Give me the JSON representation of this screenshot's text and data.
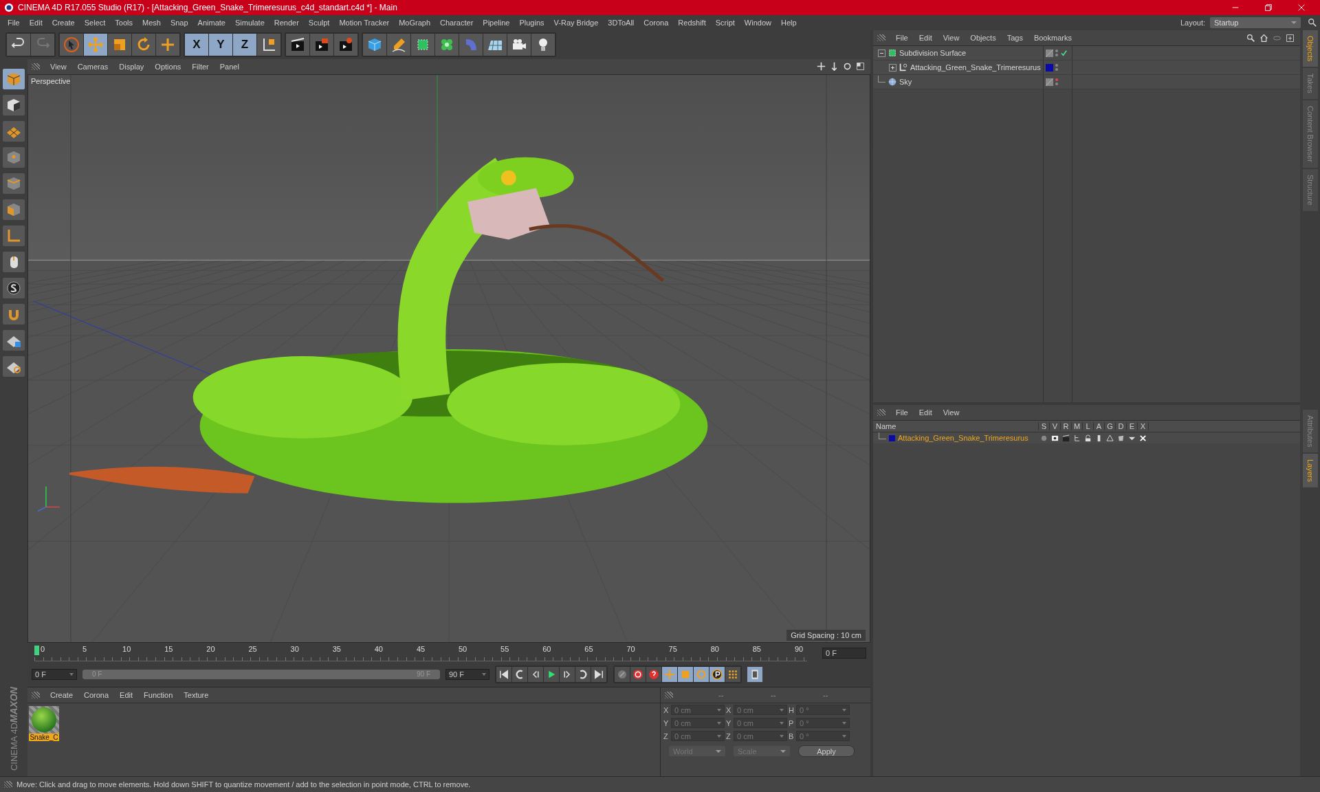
{
  "title_bar": {
    "title": "CINEMA 4D R17.055 Studio (R17) - [Attacking_Green_Snake_Trimeresurus_c4d_standart.c4d *] - Main"
  },
  "menu_bar": {
    "items": [
      "File",
      "Edit",
      "Create",
      "Select",
      "Tools",
      "Mesh",
      "Snap",
      "Animate",
      "Simulate",
      "Render",
      "Sculpt",
      "Motion Tracker",
      "MoGraph",
      "Character",
      "Pipeline",
      "Plugins",
      "V-Ray Bridge",
      "3DToAll",
      "Corona",
      "Redshift",
      "Script",
      "Window",
      "Help"
    ],
    "layout_label": "Layout:",
    "layout_value": "Startup"
  },
  "toolbar": {
    "axis_buttons": [
      {
        "label": "X",
        "on": true
      },
      {
        "label": "Y",
        "on": true
      },
      {
        "label": "Z",
        "on": true
      }
    ]
  },
  "viewport": {
    "menu": [
      "View",
      "Cameras",
      "Display",
      "Options",
      "Filter",
      "Panel"
    ],
    "camera": "Perspective",
    "grid_spacing": "Grid Spacing : 10 cm"
  },
  "timeline": {
    "ticks": [
      "0",
      "5",
      "10",
      "15",
      "20",
      "25",
      "30",
      "35",
      "40",
      "45",
      "50",
      "55",
      "60",
      "65",
      "70",
      "75",
      "80",
      "85",
      "90"
    ],
    "current_frame": "0 F",
    "start_field": "0 F",
    "range": {
      "start": "0 F",
      "end": "90 F",
      "level": 1
    },
    "end_field": "90 F"
  },
  "material_manager": {
    "menu": [
      "Create",
      "Corona",
      "Edit",
      "Function",
      "Texture"
    ],
    "materials": [
      {
        "name": "Snake_C",
        "selected": true
      }
    ]
  },
  "coordinates": {
    "headers": [
      "--",
      "--",
      "--"
    ],
    "rows": [
      {
        "cells": [
          {
            "label": "X",
            "value": "0 cm"
          },
          {
            "label": "X",
            "value": "0 cm"
          },
          {
            "label": "H",
            "value": "0 °"
          }
        ]
      },
      {
        "cells": [
          {
            "label": "Y",
            "value": "0 cm"
          },
          {
            "label": "Y",
            "value": "0 cm"
          },
          {
            "label": "P",
            "value": "0 °"
          }
        ]
      },
      {
        "cells": [
          {
            "label": "Z",
            "value": "0 cm"
          },
          {
            "label": "Z",
            "value": "0 cm"
          },
          {
            "label": "B",
            "value": "0 °"
          }
        ]
      }
    ],
    "dropdowns": [
      "World",
      "Scale"
    ],
    "apply": "Apply"
  },
  "object_manager": {
    "menu": [
      "File",
      "Edit",
      "View",
      "Objects",
      "Tags",
      "Bookmarks"
    ],
    "objects": [
      {
        "name": "Subdivision Surface",
        "kind": "subdivision",
        "expanded": true,
        "enabled": true,
        "render_off": false,
        "children": [
          {
            "name": "Attacking_Green_Snake_Trimeresurus",
            "kind": "polygon",
            "expanded": false,
            "color": "#0a0aa8",
            "enabled": false,
            "render_off": false
          }
        ]
      },
      {
        "name": "Sky",
        "kind": "sky",
        "enabled": false,
        "render_off": true
      }
    ]
  },
  "layer_manager": {
    "menu": [
      "File",
      "Edit",
      "View"
    ],
    "name_column": "Name",
    "columns": [
      "S",
      "V",
      "R",
      "M",
      "L",
      "A",
      "G",
      "D",
      "E",
      "X"
    ],
    "layers": [
      {
        "name": "Attacking_Green_Snake_Trimeresurus",
        "color": "#0a0aa8",
        "selected": true
      }
    ]
  },
  "side_tabs_top": [
    {
      "label": "Objects",
      "selected": true
    },
    {
      "label": "Takes",
      "selected": false
    },
    {
      "label": "Content Browser",
      "selected": false
    },
    {
      "label": "Structure",
      "selected": false
    }
  ],
  "side_tabs_bottom": [
    {
      "label": "Attributes",
      "selected": false
    },
    {
      "label": "Layers",
      "selected": true
    }
  ],
  "logo": {
    "brand": "MAXON",
    "product": "CINEMA 4D"
  },
  "status_bar": {
    "text": "Move: Click and drag to move elements. Hold down SHIFT to quantize movement / add to the selection in point mode, CTRL to remove."
  }
}
